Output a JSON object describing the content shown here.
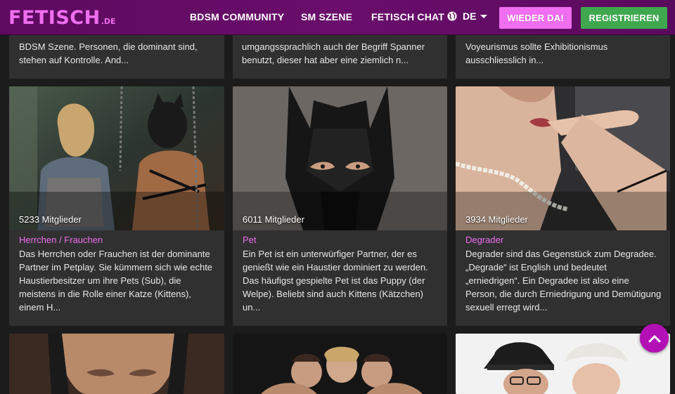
{
  "header": {
    "logo_main": "FETISCH",
    "logo_tld": ".DE",
    "nav": [
      "BDSM COMMUNITY",
      "SM SZENE",
      "FETISCH CHAT"
    ],
    "language": "DE",
    "btn_back": "WIEDER DA!",
    "btn_register": "REGISTRIEREN"
  },
  "top_row": [
    {
      "desc": "BDSM Szene. Personen, die dominant sind, stehen auf Kontrolle. And..."
    },
    {
      "desc": "umgangssprachlich auch der Begriff Spanner benutzt, dieser hat aber eine ziemlich n..."
    },
    {
      "desc": "Voyeurismus sollte Exhibitionismus ausschliesslich in..."
    }
  ],
  "cards": [
    {
      "members": "5233 Mitglieder",
      "title": "Herrchen / Frauchen",
      "desc": "Das Herrchen oder Frauchen ist der dominante Partner im Petplay. Sie kümmern sich wie echte Haustierbesitzer um ihre Pets (Sub), die meistens in die Rolle einer Katze (Kittens), einem H..."
    },
    {
      "members": "6011 Mitglieder",
      "title": "Pet",
      "desc": "Ein Pet ist ein unterwürfiger Partner, der es genießt wie ein Haustier dominiert zu werden. Das häufigst gespielte Pet ist das Puppy (der Welpe). Beliebt sind auch Kittens (Kätzchen) un..."
    },
    {
      "members": "3934 Mitglieder",
      "title": "Degrader",
      "desc": "Degrader sind das Gegenstück zum Degradee. „Degrade“ ist English und bedeutet „erniedrigen“. Ein Degradee ist also eine Person, die durch Erniedrigung und Demütigung sexuell erregt wird..."
    }
  ],
  "icons": {
    "language": "globe-icon",
    "language_toggle": "caret-down-icon",
    "scroll_top": "chevron-up-icon"
  },
  "colors": {
    "brand": "#f06ef0",
    "header_bg": "#62095f",
    "register": "#3fa84f",
    "card_bg": "#303030",
    "page_bg": "#1c1c1c"
  }
}
